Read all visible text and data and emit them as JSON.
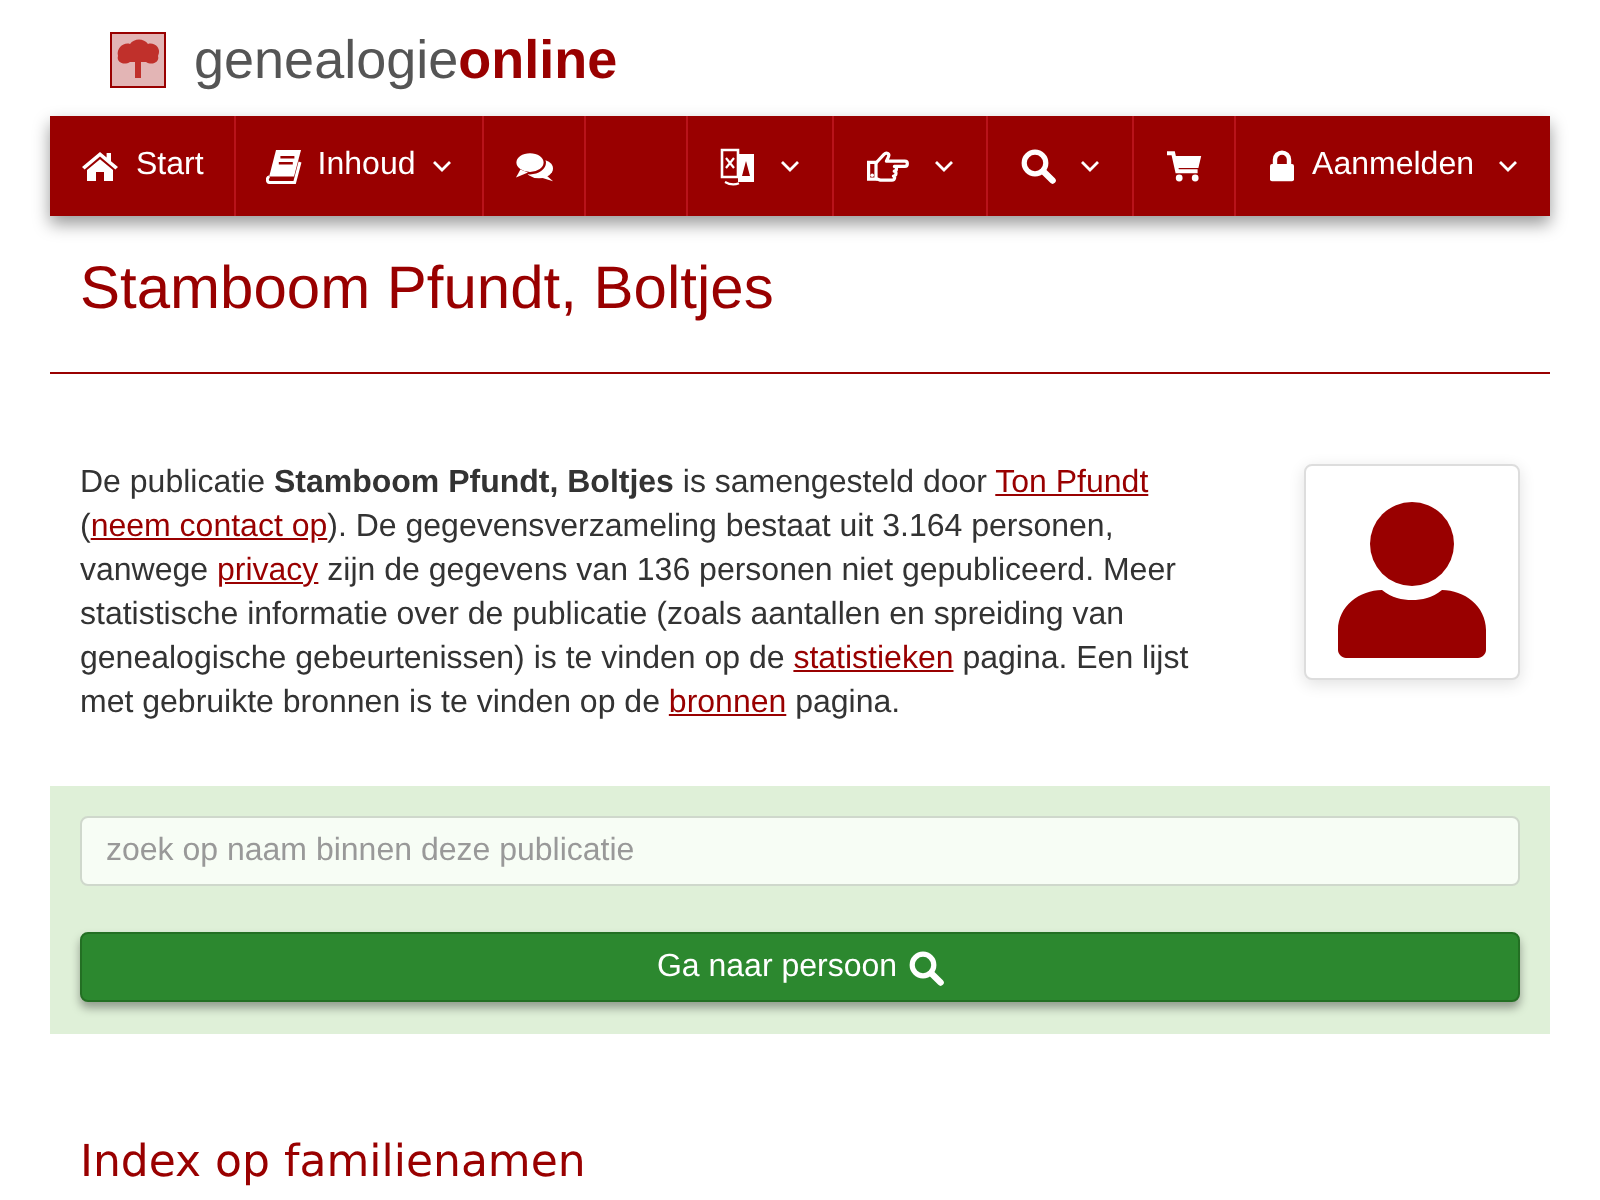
{
  "header": {
    "logo": {
      "text": "genealogie**online**"
    }
  },
  "navbar": {
    "left_items": [
      {
        "kind": "home",
        "label": "Start",
        "has_menu": false
      },
      {
        "kind": "contents",
        "label": "Inhoud",
        "has_menu": true
      },
      {
        "kind": "chat",
        "has_menu": false
      }
    ],
    "right_items": [
      {
        "kind": "language",
        "has_menu": true
      },
      {
        "kind": "recommend",
        "has_menu": true
      },
      {
        "kind": "search",
        "has_menu": true
      },
      {
        "kind": "cart",
        "has_menu": false
      },
      {
        "kind": "login",
        "label": "Aanmelden",
        "has_menu": true
      }
    ]
  },
  "page": {
    "title": "Stamboom Pfundt, Boltjes"
  },
  "intro": {
    "parts": [
      {
        "kind": "text",
        "text": "De publicatie **Stamboom Pfundt, Boltjes** is samengesteld door "
      },
      {
        "kind": "link",
        "text": "Ton Pfundt"
      },
      {
        "kind": "text",
        "text": " ("
      },
      {
        "kind": "link",
        "text": "neem contact op"
      },
      {
        "kind": "text",
        "text": "). De gegevensverzameling bestaat uit 3.164 personen, vanwege "
      },
      {
        "kind": "link",
        "text": "privacy"
      },
      {
        "kind": "text",
        "text": " zijn de gegevens van 136 personen niet gepubliceerd. Meer statistische informatie over de publicatie (zoals aantallen en spreiding van genealogische gebeurtenissen) is te vinden op de "
      },
      {
        "kind": "link",
        "text": "statistieken"
      },
      {
        "kind": "text",
        "text": " pagina. Een lijst met gebruikte bronnen is te vinden op de "
      },
      {
        "kind": "link",
        "text": "bronnen"
      },
      {
        "kind": "text",
        "text": " pagina."
      }
    ]
  },
  "person_search": {
    "placeholder": "zoek op naam binnen deze publicatie",
    "button": "Ga naar persoon"
  },
  "families_index": {
    "title": "Index op familienamen"
  }
}
